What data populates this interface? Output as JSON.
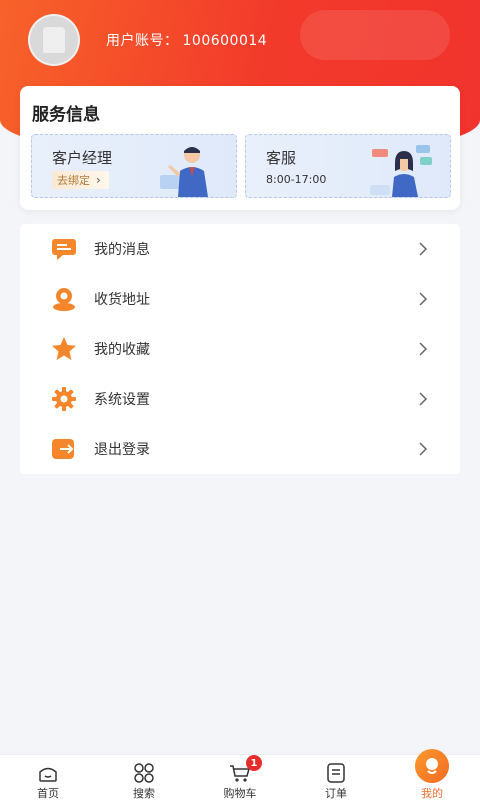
{
  "profile": {
    "account_label": "用户账号：",
    "account_number": "100600014"
  },
  "service": {
    "title": "服务信息",
    "manager": {
      "title": "客户经理",
      "bind_label": "去绑定"
    },
    "support": {
      "title": "客服",
      "hours": "8:00-17:00"
    }
  },
  "menu": {
    "items": [
      {
        "label": "我的消息",
        "icon": "message-icon"
      },
      {
        "label": "收货地址",
        "icon": "location-icon"
      },
      {
        "label": "我的收藏",
        "icon": "star-icon"
      },
      {
        "label": "系统设置",
        "icon": "gear-icon"
      },
      {
        "label": "退出登录",
        "icon": "logout-icon"
      }
    ]
  },
  "tabbar": {
    "items": [
      {
        "label": "首页",
        "icon": "home-icon"
      },
      {
        "label": "搜索",
        "icon": "grid-icon"
      },
      {
        "label": "购物车",
        "icon": "cart-icon",
        "badge": "1"
      },
      {
        "label": "订单",
        "icon": "order-icon"
      },
      {
        "label": "我的",
        "icon": "profile-icon",
        "active": true
      }
    ]
  },
  "colors": {
    "header_start": "#f7622a",
    "header_end": "#f1332d",
    "menu_icon": "#f5862b",
    "active_tab": "#f26f30",
    "badge": "#e72c2c"
  }
}
